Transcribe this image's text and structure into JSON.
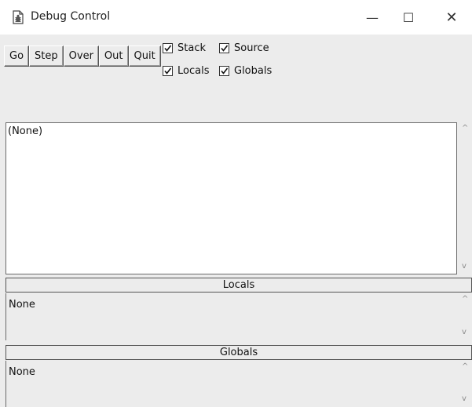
{
  "window": {
    "title": "Debug Control",
    "minimize_glyph": "—",
    "maximize_glyph": "☐",
    "close_glyph": "✕",
    "icon": "debug-document-icon"
  },
  "toolbar": {
    "buttons": [
      "Go",
      "Step",
      "Over",
      "Out",
      "Quit"
    ]
  },
  "checkboxes": {
    "stack": {
      "label": "Stack",
      "checked": true
    },
    "source": {
      "label": "Source",
      "checked": true
    },
    "locals": {
      "label": "Locals",
      "checked": true
    },
    "globals": {
      "label": "Globals",
      "checked": true
    }
  },
  "stack_panel": {
    "text": "(None)"
  },
  "locals_panel": {
    "header": "Locals",
    "text": "None"
  },
  "globals_panel": {
    "header": "Globals",
    "text": "None"
  },
  "scroll": {
    "up": "^",
    "down": "v"
  }
}
